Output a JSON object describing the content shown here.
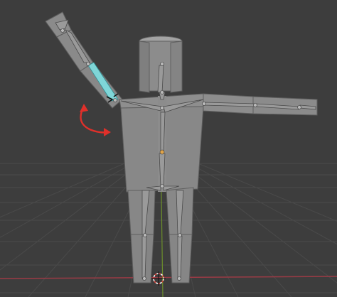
{
  "viewport": {
    "mode": "pose",
    "background_color": "#3d3d3d",
    "grid_color": "#4a4a4a",
    "x_axis_color": "#9b3b45",
    "y_axis_color": "#6c8f2b"
  },
  "mesh": {
    "name": "character-mesh",
    "body_color": "#8d8d8d",
    "edge_color": "#5f5f5f"
  },
  "armature": {
    "bone_color": "#9a9a9a",
    "bone_outline": "#4a4a4a",
    "selected_bone_color": "#7fd6d8",
    "joint_color": "#b9b9b9",
    "hip_joint_color": "#e0a44a"
  },
  "overlays": {
    "rotation_hint": "counter-clockwise-arrow-icon",
    "rotation_hint_color": "#e0302a",
    "origin_marker": "3d-cursor-icon",
    "origin_marker_colors": [
      "#d9413a",
      "#ffffff"
    ]
  }
}
